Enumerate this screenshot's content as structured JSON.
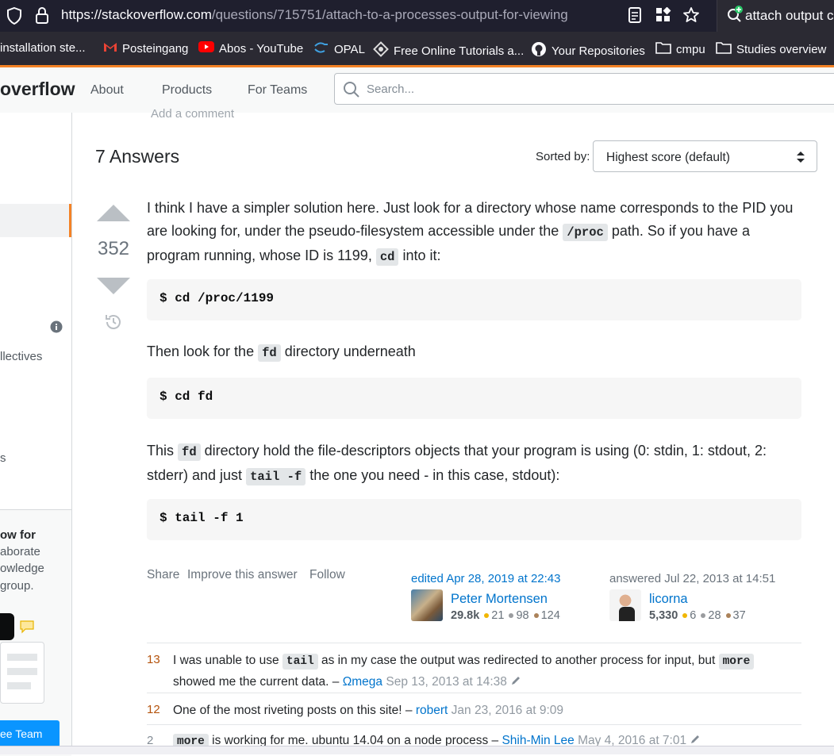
{
  "browser": {
    "url_host": "https://stackoverflow.com",
    "url_path": "/questions/715751/attach-to-a-processes-output-for-viewing",
    "tab_title": "attach output c",
    "bookmarks": [
      {
        "label": "installation ste...",
        "icon": "page-icon"
      },
      {
        "label": "Posteingang",
        "icon": "gmail-icon"
      },
      {
        "label": "Abos - YouTube",
        "icon": "youtube-icon"
      },
      {
        "label": "OPAL",
        "icon": "opal-icon"
      },
      {
        "label": "Free Online Tutorials a...",
        "icon": "tutorials-icon"
      },
      {
        "label": "Your Repositories",
        "icon": "github-icon"
      },
      {
        "label": "cmpu",
        "icon": "folder-icon"
      },
      {
        "label": "Studies overview",
        "icon": "folder-icon"
      }
    ]
  },
  "header": {
    "logo": "overflow",
    "nav": [
      "About",
      "Products",
      "For Teams"
    ],
    "search_placeholder": "Search..."
  },
  "sidebar": {
    "collectives": "llectives",
    "s": "s",
    "teams_title": "ow for",
    "teams_lines": [
      "aborate",
      "owledge",
      " group."
    ],
    "cta": "ee Team"
  },
  "main": {
    "add_comment": "Add a comment",
    "answers_count": "7 Answers",
    "sorted_by": "Sorted by:",
    "sort_value": "Highest score (default)"
  },
  "answer": {
    "score": "352",
    "p1_a": "I think I have a simpler solution here. Just look for a directory whose name corresponds to the PID you are looking for, under the pseudo-filesystem accessible under the ",
    "p1_code1": "/proc",
    "p1_b": " path. So if you have a program running, whose ID is 1199, ",
    "p1_code2": "cd",
    "p1_c": " into it:",
    "code1": "$ cd /proc/1199",
    "p2_a": "Then look for the ",
    "p2_code": "fd",
    "p2_b": " directory underneath",
    "code2": "$ cd fd",
    "p3_a": "This ",
    "p3_code1": "fd",
    "p3_b": " directory hold the file-descriptors objects that your program is using (0: stdin, 1: stdout, 2: stderr) and just ",
    "p3_code2": "tail -f",
    "p3_c": " the one you need - in this case, stdout):",
    "code3": "$ tail -f 1",
    "menu": [
      "Share",
      "Improve this answer",
      "Follow"
    ],
    "edited": {
      "action": "edited Apr 28, 2019 at 22:43",
      "name": "Peter Mortensen",
      "rep": "29.8k",
      "gold": "21",
      "silver": "98",
      "bronze": "124"
    },
    "answered": {
      "action": "answered Jul 22, 2013 at 14:51",
      "name": "licorna",
      "rep": "5,330",
      "gold": "6",
      "silver": "28",
      "bronze": "37"
    }
  },
  "comments": [
    {
      "score": "13",
      "text_a": "I was unable to use ",
      "code_a": "tail",
      "text_b": " as in my case the output was redirected to another process for input, but ",
      "code_b": "more",
      "text_c": " showed me the current data. – ",
      "user": "Ωmega",
      "date": "Sep 13, 2013 at 14:38"
    },
    {
      "score": "12",
      "text": "One of the most riveting posts on this site! – ",
      "user": "robert",
      "date": "Jan 23, 2016 at 9:09"
    },
    {
      "score": "2",
      "code": "more",
      "text": " is working for me. ubuntu 14.04 on a node process – ",
      "user": "Shih-Min Lee",
      "date": "May 4, 2016 at 7:01"
    }
  ],
  "colors": {
    "accent": "#f48225",
    "link": "#0074cc",
    "gold": "#f1b600",
    "silver": "#9a9c9f",
    "bronze": "#ab8259"
  }
}
